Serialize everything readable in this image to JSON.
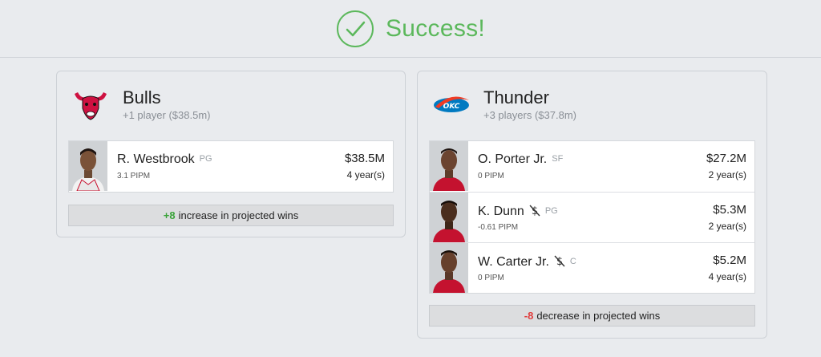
{
  "header": {
    "title": "Success!",
    "icon": "check-circle-icon",
    "accent": "#5cb85c"
  },
  "teams": [
    {
      "name": "Bulls",
      "summary": "+1 player ($38.5m)",
      "logo": "bulls-logo",
      "players": [
        {
          "name": "R. Westbrook",
          "position": "PG",
          "pipm": "3.1 PIPM",
          "salary": "$38.5M",
          "years": "4 year(s)",
          "no_dollar": false
        }
      ],
      "wins": {
        "value": "+8",
        "label": "increase in projected wins",
        "color": "#3aa33a"
      }
    },
    {
      "name": "Thunder",
      "summary": "+3 players ($37.8m)",
      "logo": "thunder-logo",
      "players": [
        {
          "name": "O. Porter Jr.",
          "position": "SF",
          "pipm": "0 PIPM",
          "salary": "$27.2M",
          "years": "2 year(s)",
          "no_dollar": false
        },
        {
          "name": "K. Dunn",
          "position": "PG",
          "pipm": "-0.61 PIPM",
          "salary": "$5.3M",
          "years": "2 year(s)",
          "no_dollar": true
        },
        {
          "name": "W. Carter Jr.",
          "position": "C",
          "pipm": "0 PIPM",
          "salary": "$5.2M",
          "years": "4 year(s)",
          "no_dollar": true
        }
      ],
      "wins": {
        "value": "-8",
        "label": "decrease in projected wins",
        "color": "#e03c3c"
      }
    }
  ]
}
